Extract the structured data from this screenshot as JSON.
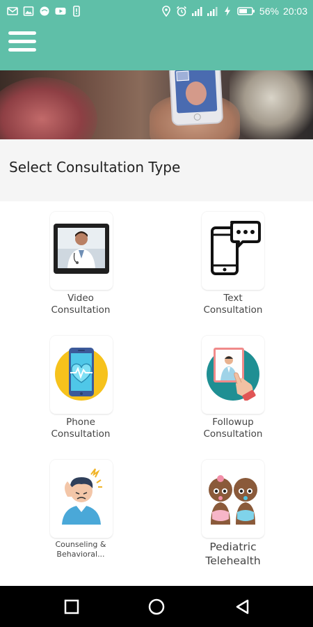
{
  "status_bar": {
    "left_icons": [
      "mail-icon",
      "image-icon",
      "circle-app-icon",
      "youtube-icon",
      "phone-alert-icon"
    ],
    "right_icons": [
      "location-icon",
      "alarm-icon",
      "signal-icon",
      "signal-hd-icon",
      "charging-icon",
      "battery-icon"
    ],
    "battery": "56%",
    "time": "20:03"
  },
  "app_bar": {
    "menu_icon": "hamburger-menu-icon",
    "color": "#5fbfa8"
  },
  "section": {
    "title": "Select Consultation Type"
  },
  "consultations": [
    {
      "label_line1": "Video",
      "label_line2": "Consultation",
      "icon": "video-doctor-icon"
    },
    {
      "label_line1": "Text",
      "label_line2": "Consultation",
      "icon": "chat-phone-icon"
    },
    {
      "label_line1": "Phone",
      "label_line2": "Consultation",
      "icon": "heart-phone-icon"
    },
    {
      "label_line1": "Followup",
      "label_line2": "Consultation",
      "icon": "tablet-doctor-icon"
    },
    {
      "label_line1": "Counseling &",
      "label_line2": "Behavioral...",
      "icon": "stressed-person-icon"
    },
    {
      "label_line1": "Pediatric",
      "label_line2": "Telehealth",
      "icon": "babies-icon"
    }
  ],
  "nav_bar": {
    "icons": [
      "recents-square-icon",
      "home-circle-icon",
      "back-triangle-icon"
    ]
  }
}
